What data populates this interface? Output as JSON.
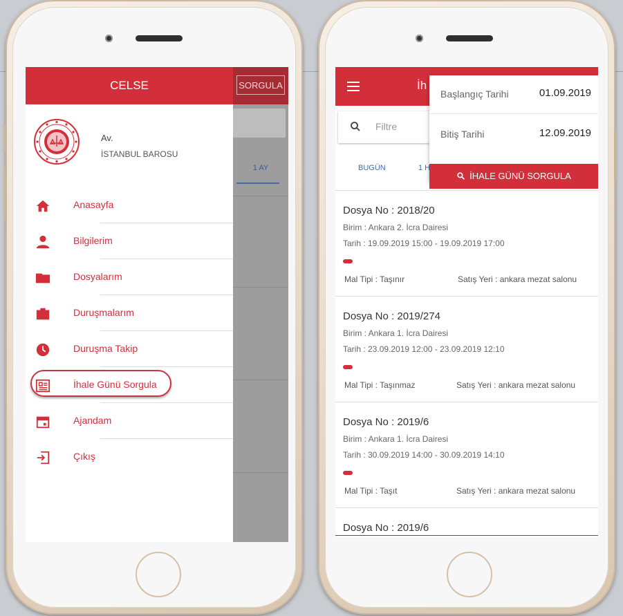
{
  "drawer": {
    "title": "CELSE",
    "profile_name": "Av.",
    "profile_org": "İSTANBUL BAROSU",
    "items": [
      {
        "label": "Anasayfa",
        "icon": "home-icon"
      },
      {
        "label": "Bilgilerim",
        "icon": "person-icon"
      },
      {
        "label": "Dosyalarım",
        "icon": "folder-icon"
      },
      {
        "label": "Duruşmalarım",
        "icon": "briefcase-icon"
      },
      {
        "label": "Duruşma Takip",
        "icon": "clock-icon"
      },
      {
        "label": "İhale Günü Sorgula",
        "icon": "newspaper-icon",
        "highlighted": true
      },
      {
        "label": "Ajandam",
        "icon": "calendar-icon"
      },
      {
        "label": "Çıkış",
        "icon": "exit-icon"
      }
    ]
  },
  "behind": {
    "sorgula_label": "SORGULA",
    "tab_label": "1 AY"
  },
  "right": {
    "title_fragment": "İh",
    "search_placeholder": "Filtre",
    "tabs": [
      "BUGÜN",
      "1 H"
    ],
    "popup": {
      "start_label": "Başlangıç Tarihi",
      "start_value": "01.09.2019",
      "end_label": "Bitiş Tarihi",
      "end_value": "12.09.2019",
      "button_label": "İHALE GÜNÜ SORGULA"
    },
    "records": [
      {
        "dosya": "Dosya No : 2018/20",
        "birim": "Birim : Ankara 2. İcra Dairesi",
        "tarih": "Tarih : 19.09.2019 15:00 - 19.09.2019 17:00",
        "mal": "Mal Tipi : Taşınır",
        "satis": "Satış Yeri : ankara mezat salonu"
      },
      {
        "dosya": "Dosya No : 2019/274",
        "birim": "Birim : Ankara 1. İcra Dairesi",
        "tarih": "Tarih : 23.09.2019 12:00 - 23.09.2019 12:10",
        "mal": "Mal Tipi : Taşınmaz",
        "satis": "Satış Yeri : ankara mezat salonu"
      },
      {
        "dosya": "Dosya No : 2019/6",
        "birim": "Birim : Ankara 1. İcra Dairesi",
        "tarih": "Tarih : 30.09.2019 14:00 - 30.09.2019 14:10",
        "mal": "Mal Tipi : Taşıt",
        "satis": "Satış Yeri : ankara mezat salonu"
      },
      {
        "dosya": "Dosya No : 2019/6"
      }
    ]
  },
  "colors": {
    "brand_red": "#d32f3a",
    "tab_blue": "#3f6bb0"
  }
}
